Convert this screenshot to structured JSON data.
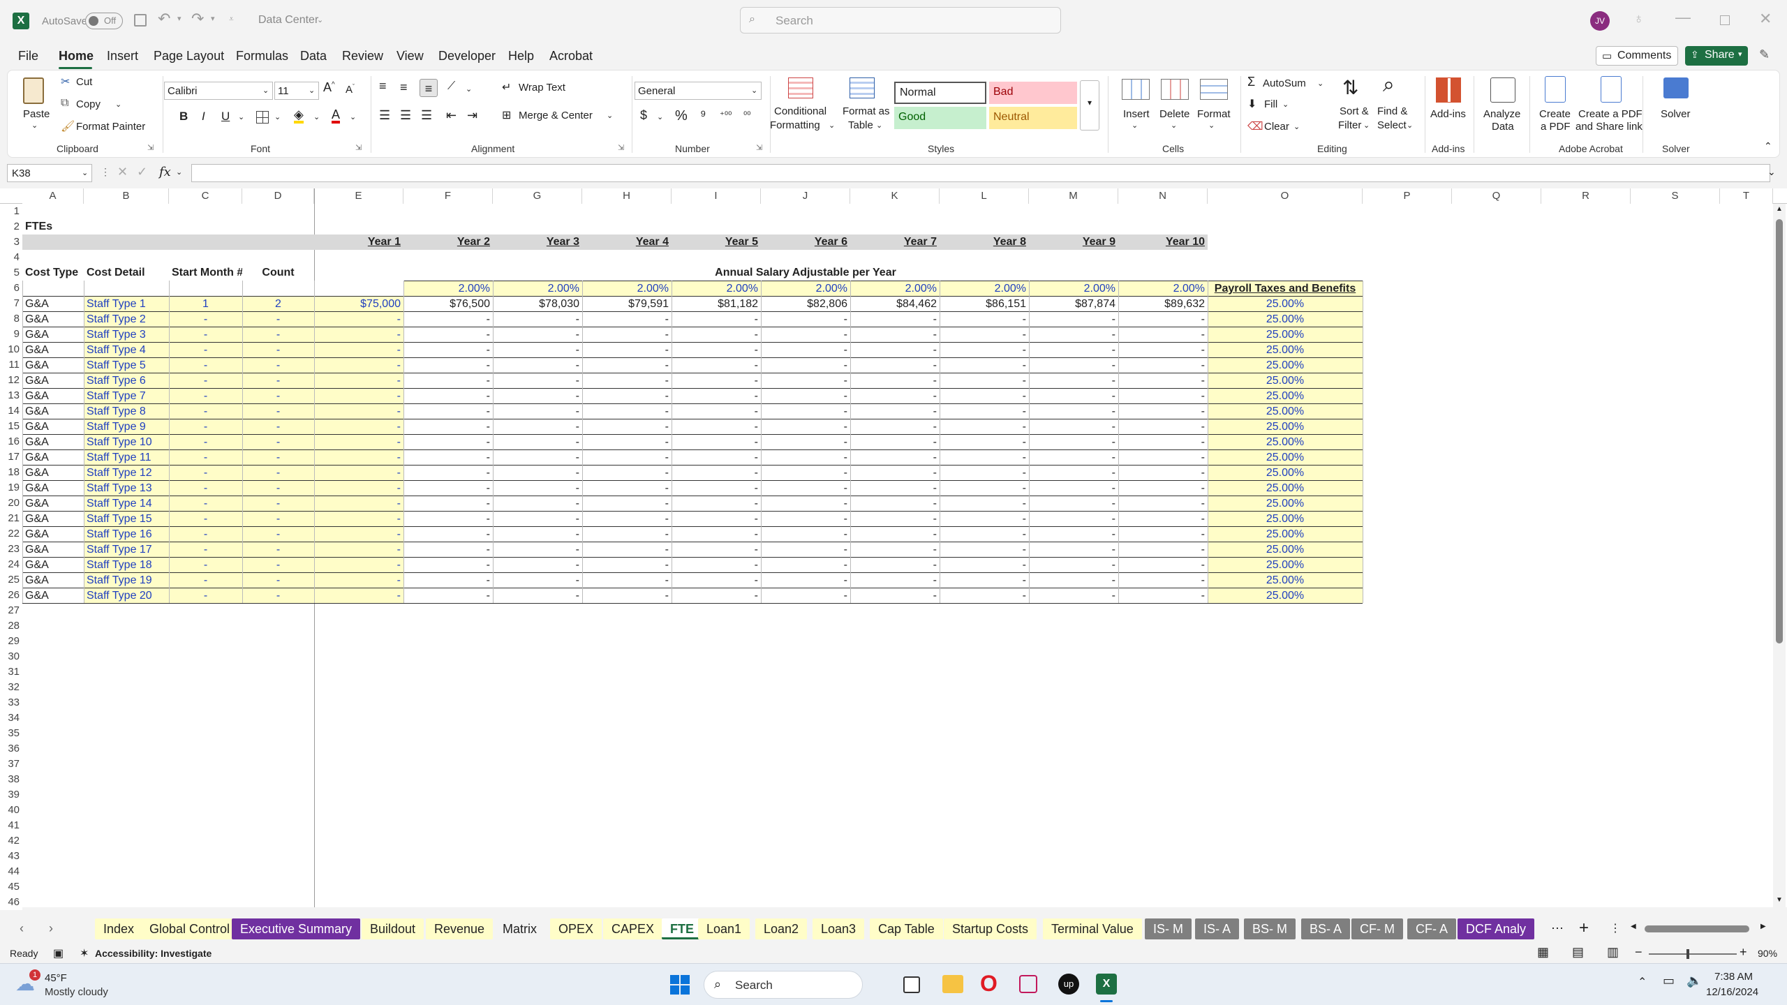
{
  "titlebar": {
    "autosave_label": "AutoSave",
    "autosave_state": "Off",
    "doc_title": "Data Center",
    "search_placeholder": "Search",
    "user_initials": "JV"
  },
  "menu": [
    "File",
    "Home",
    "Insert",
    "Page Layout",
    "Formulas",
    "Data",
    "Review",
    "View",
    "Developer",
    "Help",
    "Acrobat"
  ],
  "menu_right": {
    "comments": "Comments",
    "share": "Share"
  },
  "ribbon": {
    "clipboard": {
      "paste": "Paste",
      "cut": "Cut",
      "copy": "Copy",
      "format_painter": "Format Painter",
      "group": "Clipboard"
    },
    "font": {
      "name": "Calibri",
      "size": "11",
      "bold": "B",
      "italic": "I",
      "underline": "U",
      "group": "Font"
    },
    "alignment": {
      "wrap": "Wrap Text",
      "merge": "Merge & Center",
      "group": "Alignment"
    },
    "number": {
      "format": "General",
      "group": "Number"
    },
    "styles": {
      "cond1": "Conditional",
      "cond2": "Formatting",
      "fmt1": "Format as",
      "fmt2": "Table",
      "normal": "Normal",
      "bad": "Bad",
      "good": "Good",
      "neutral": "Neutral",
      "group": "Styles"
    },
    "cells": {
      "insert": "Insert",
      "delete": "Delete",
      "format": "Format",
      "group": "Cells"
    },
    "editing": {
      "autosum": "AutoSum",
      "fill": "Fill",
      "clear": "Clear",
      "sort1": "Sort &",
      "sort2": "Filter",
      "find1": "Find &",
      "find2": "Select",
      "group": "Editing"
    },
    "addins": {
      "label": "Add-ins",
      "group": "Add-ins"
    },
    "analyze": {
      "l1": "Analyze",
      "l2": "Data"
    },
    "acrobat": {
      "c1": "Create",
      "c2": "a PDF",
      "s1": "Create a PDF",
      "s2": "and Share link",
      "group": "Adobe Acrobat"
    },
    "solver": {
      "label": "Solver",
      "group": "Solver"
    }
  },
  "formula_bar": {
    "name_box": "K38",
    "fx": "fx",
    "value": ""
  },
  "columns": [
    "A",
    "B",
    "C",
    "D",
    "E",
    "F",
    "G",
    "H",
    "I",
    "J",
    "K",
    "L",
    "M",
    "N",
    "O",
    "P",
    "Q",
    "R",
    "S",
    "T"
  ],
  "sheet": {
    "title": "FTEs",
    "years": [
      "Year 1",
      "Year 2",
      "Year 3",
      "Year 4",
      "Year 5",
      "Year 6",
      "Year 7",
      "Year 8",
      "Year 9",
      "Year 10"
    ],
    "headers": {
      "cost_type": "Cost Type",
      "cost_detail": "Cost Detail",
      "start_month": "Start Month #",
      "count": "Count",
      "annual": "Annual Salary Adjustable per Year",
      "payroll": "Payroll Taxes and Benefits"
    },
    "growth": [
      "2.00%",
      "2.00%",
      "2.00%",
      "2.00%",
      "2.00%",
      "2.00%",
      "2.00%",
      "2.00%",
      "2.00%"
    ],
    "row1": {
      "type": "G&A",
      "detail": "Staff Type 1",
      "start": "1",
      "count": "2",
      "salaries": [
        "$75,000",
        "$76,500",
        "$78,030",
        "$79,591",
        "$81,182",
        "$82,806",
        "$84,462",
        "$86,151",
        "$87,874",
        "$89,632"
      ],
      "payroll": "25.00%"
    },
    "other_rows": {
      "type": "G&A",
      "details": [
        "Staff Type 2",
        "Staff Type 3",
        "Staff Type 4",
        "Staff Type 5",
        "Staff Type 6",
        "Staff Type 7",
        "Staff Type 8",
        "Staff Type 9",
        "Staff Type 10",
        "Staff Type 11",
        "Staff Type 12",
        "Staff Type 13",
        "Staff Type 14",
        "Staff Type 15",
        "Staff Type 16",
        "Staff Type 17",
        "Staff Type 18",
        "Staff Type 19",
        "Staff Type 20"
      ],
      "dash": "-",
      "payroll": "25.00%"
    },
    "row_numbers": [
      "1",
      "2",
      "3",
      "4",
      "5",
      "6",
      "7",
      "8",
      "9",
      "10",
      "11",
      "12",
      "13",
      "14",
      "15",
      "16",
      "17",
      "18",
      "19",
      "20",
      "21",
      "22",
      "23",
      "24",
      "25",
      "26",
      "27",
      "28",
      "29",
      "30",
      "31",
      "32",
      "33",
      "34",
      "35",
      "36",
      "37",
      "38",
      "39",
      "40",
      "41",
      "42",
      "43",
      "44",
      "45",
      "46"
    ]
  },
  "tabs": [
    {
      "label": "Index",
      "bg": "#fffdc8",
      "color": "#222"
    },
    {
      "label": "Global Control",
      "bg": "#fffdc8",
      "color": "#222"
    },
    {
      "label": "Executive Summary",
      "bg": "#7030a0",
      "color": "#ffffff"
    },
    {
      "label": "Buildout",
      "bg": "#fffdc8",
      "color": "#222"
    },
    {
      "label": "Revenue",
      "bg": "#fffdc8",
      "color": "#222"
    },
    {
      "label": "Matrix",
      "bg": "#f3f3f3",
      "color": "#222"
    },
    {
      "label": "OPEX",
      "bg": "#fffdc8",
      "color": "#222"
    },
    {
      "label": "CAPEX",
      "bg": "#fffdc8",
      "color": "#222"
    },
    {
      "label": "FTE",
      "bg": "#ffffff",
      "color": "#222"
    },
    {
      "label": "Loan1",
      "bg": "#fffdc8",
      "color": "#222"
    },
    {
      "label": "Loan2",
      "bg": "#fffdc8",
      "color": "#222"
    },
    {
      "label": "Loan3",
      "bg": "#fffdc8",
      "color": "#222"
    },
    {
      "label": "Cap Table",
      "bg": "#fffdc8",
      "color": "#222"
    },
    {
      "label": "Startup Costs",
      "bg": "#fffdc8",
      "color": "#222"
    },
    {
      "label": "Terminal Value",
      "bg": "#fffdc8",
      "color": "#222"
    },
    {
      "label": "IS- M",
      "bg": "#7f7f7f",
      "color": "#ffffff"
    },
    {
      "label": "IS- A",
      "bg": "#7f7f7f",
      "color": "#ffffff"
    },
    {
      "label": "BS- M",
      "bg": "#7f7f7f",
      "color": "#ffffff"
    },
    {
      "label": "BS- A",
      "bg": "#7f7f7f",
      "color": "#ffffff"
    },
    {
      "label": "CF- M",
      "bg": "#7f7f7f",
      "color": "#ffffff"
    },
    {
      "label": "CF- A",
      "bg": "#7f7f7f",
      "color": "#ffffff"
    },
    {
      "label": "DCF Analy",
      "bg": "#7030a0",
      "color": "#ffffff"
    }
  ],
  "status": {
    "ready": "Ready",
    "accessibility": "Accessibility: Investigate",
    "zoom": "90%"
  },
  "taskbar": {
    "temp": "45°F",
    "weather": "Mostly cloudy",
    "badge": "1",
    "search": "Search",
    "time": "7:38 AM",
    "date": "12/16/2024"
  }
}
